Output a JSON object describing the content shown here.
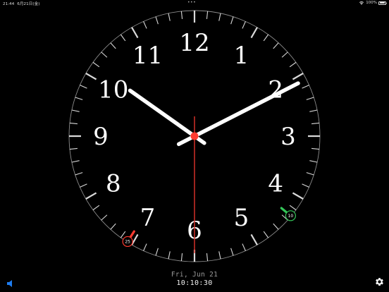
{
  "status_bar": {
    "time": "21:44",
    "date": "6月21日(金)",
    "dots": "•••",
    "battery_percent": "100%",
    "battery_level": 1.0
  },
  "clock": {
    "numerals": [
      "12",
      "1",
      "2",
      "3",
      "4",
      "5",
      "6",
      "7",
      "8",
      "9",
      "10",
      "11"
    ],
    "hour_hand_hours": 10.175,
    "minute_hand_minutes": 10.5,
    "second_hand_seconds": 30,
    "markers": [
      {
        "label": "10",
        "color": "#34c759",
        "minute_position": 21.6
      },
      {
        "label": "25",
        "color": "#ff3b30",
        "minute_position": 35.4
      }
    ],
    "colors": {
      "face": "#000000",
      "ticks": "#ffffff",
      "hands": "#ffffff",
      "second_hand": "#e0342c",
      "center_dot": "#ff3b30"
    }
  },
  "footer": {
    "date_text": "Fri, Jun 21",
    "time_text": "10:10:30"
  },
  "icons": {
    "sound": "speaker-icon",
    "settings": "gear-icon",
    "accent": "#1e7cf0"
  }
}
